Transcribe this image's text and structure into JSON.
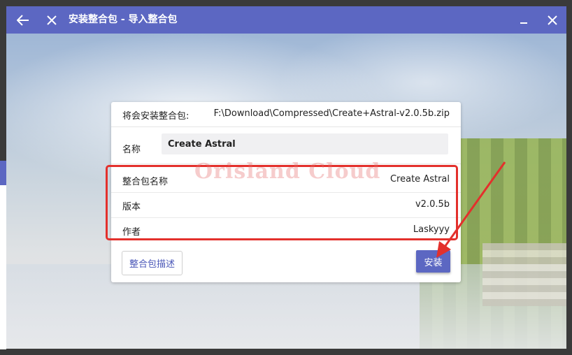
{
  "window": {
    "title": "安装整合包 - 导入整合包",
    "back_icon": "arrow-left-icon",
    "close_icon": "close-icon",
    "minimize_icon": "minimize-icon",
    "window_close_icon": "window-close-icon"
  },
  "dialog": {
    "file_label": "将会安装整合包:",
    "file_path": "F:\\Download\\Compressed\\Create+Astral-v2.0.5b.zip",
    "name_label": "名称",
    "name_value": "Create Astral",
    "info": [
      {
        "key": "整合包名称",
        "value": "Create Astral"
      },
      {
        "key": "版本",
        "value": "v2.0.5b"
      },
      {
        "key": "作者",
        "value": "Laskyyy"
      }
    ],
    "description_button": "整合包描述",
    "install_button": "安装"
  },
  "overlay": {
    "watermark": "Orisland Cloud",
    "highlight_color": "#e3302c"
  },
  "colors": {
    "accent": "#5c67c2"
  }
}
